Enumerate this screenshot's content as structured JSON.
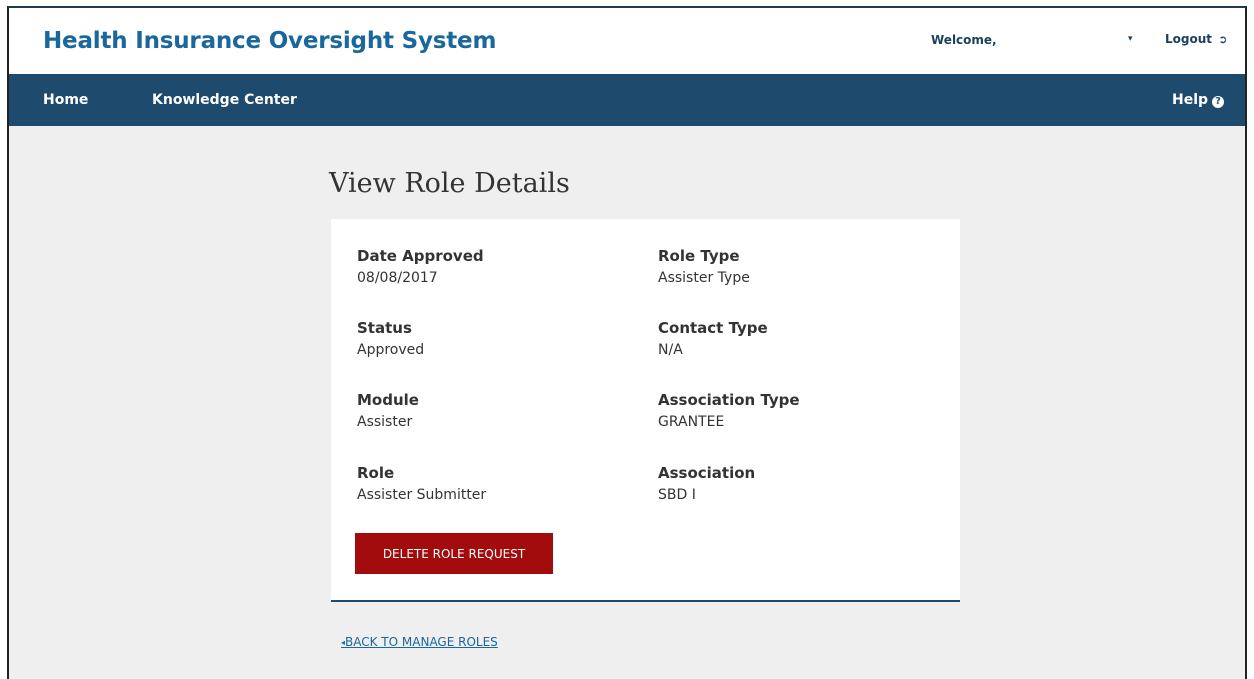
{
  "header": {
    "site_title": "Health Insurance Oversight System",
    "welcome_text": "Welcome,",
    "user_menu_caret": "▾",
    "logout_label": "Logout",
    "logout_icon": "logout-icon"
  },
  "nav": {
    "items": [
      {
        "label": "Home"
      },
      {
        "label": "Knowledge Center"
      }
    ],
    "help_label": "Help",
    "help_icon_glyph": "?"
  },
  "page": {
    "title": "View Role Details"
  },
  "details": {
    "left": [
      {
        "label": "Date Approved",
        "value": "08/08/2017"
      },
      {
        "label": "Status",
        "value": "Approved"
      },
      {
        "label": "Module",
        "value": "Assister"
      },
      {
        "label": "Role",
        "value": "Assister Submitter"
      }
    ],
    "right": [
      {
        "label": "Role Type",
        "value": "Assister Type"
      },
      {
        "label": "Contact Type",
        "value": "N/A"
      },
      {
        "label": "Association Type",
        "value": "GRANTEE"
      },
      {
        "label": "Association",
        "value": "SBD I"
      }
    ]
  },
  "actions": {
    "delete_label": "DELETE ROLE REQUEST",
    "back_label": "BACK TO MANAGE ROLES"
  },
  "colors": {
    "title_blue": "#19679c",
    "navbar": "#1e4a6d",
    "delete_red": "#a20c0c",
    "page_bg": "#efefef"
  }
}
